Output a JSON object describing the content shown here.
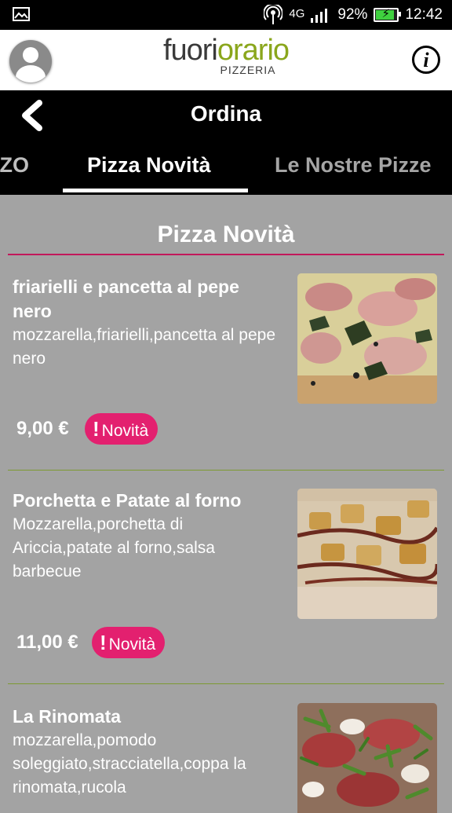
{
  "status_bar": {
    "network": "4G",
    "battery_percent": "92%",
    "battery_level": 0.92,
    "time": "12:42"
  },
  "header": {
    "logo_part1": "fuori",
    "logo_part2": "orario",
    "logo_subtitle": "PIZZERIA",
    "info_label": "i"
  },
  "nav": {
    "title": "Ordina",
    "tabs": [
      {
        "label": "IZO"
      },
      {
        "label": "Pizza Novità"
      },
      {
        "label": "Le Nostre Pizze"
      }
    ]
  },
  "section": {
    "title": "Pizza Novità"
  },
  "products": [
    {
      "name": "friarielli e pancetta al pepe nero",
      "description": "mozzarella,friarielli,pancetta al pepe nero",
      "price": "9,00 €",
      "badge": "Novità"
    },
    {
      "name": "Porchetta e Patate al forno",
      "description": "Mozzarella,porchetta di Ariccia,patate al forno,salsa barbecue",
      "price": "11,00 €",
      "badge": "Novità"
    },
    {
      "name": "La Rinomata",
      "description": "mozzarella,pomodo soleggiato,stracciatella,coppa la rinomata,rucola"
    }
  ],
  "colors": {
    "accent_badge": "#e3206f",
    "section_rule": "#c2185b",
    "divider": "#7d9a32",
    "logo_green": "#8aa61c",
    "background": "#a3a3a3"
  }
}
